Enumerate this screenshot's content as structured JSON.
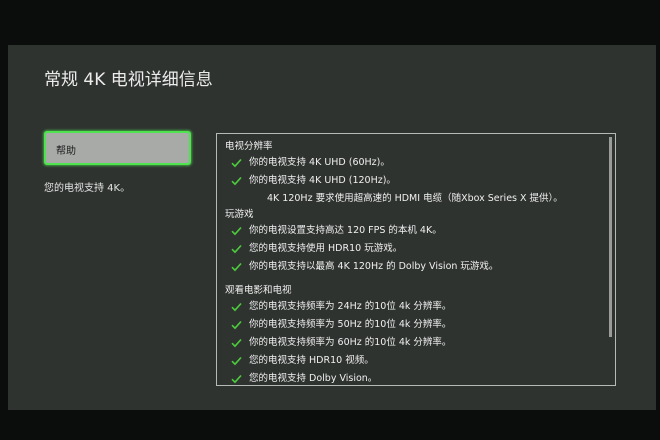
{
  "page": {
    "title": "常规  4K 电视详细信息"
  },
  "left": {
    "help_label": "帮助",
    "support_note": "您的电视支持 4K。"
  },
  "sections": [
    {
      "title": "电视分辨率",
      "items": [
        "你的电视支持 4K UHD (60Hz)。",
        "你的电视支持 4K UHD (120Hz)。"
      ],
      "note": "4K 120Hz 要求使用超高速的 HDMI 电缆（随Xbox Series X 提供）。"
    },
    {
      "title": "玩游戏",
      "items": [
        "你的电视设置支持高达 120 FPS 的本机 4K。",
        "您的电视支持使用 HDR10 玩游戏。",
        "你的电视支持以最高 4K 120Hz 的 Dolby Vision 玩游戏。"
      ]
    },
    {
      "title": "观看电影和电视",
      "items": [
        "您的电视支持频率为 24Hz 的10位 4k 分辨率。",
        "你的电视支持频率为 50Hz 的10位 4k 分辨率。",
        "你的电视支持频率为 60Hz 的10位 4k 分辨率。",
        "您的电视支持 HDR10 视频。",
        "您的电视支持 Dolby Vision。"
      ]
    }
  ],
  "colors": {
    "check": "#4ccc3c",
    "focus": "#4fe34f"
  },
  "icons": {
    "check": "checkmark-icon"
  }
}
